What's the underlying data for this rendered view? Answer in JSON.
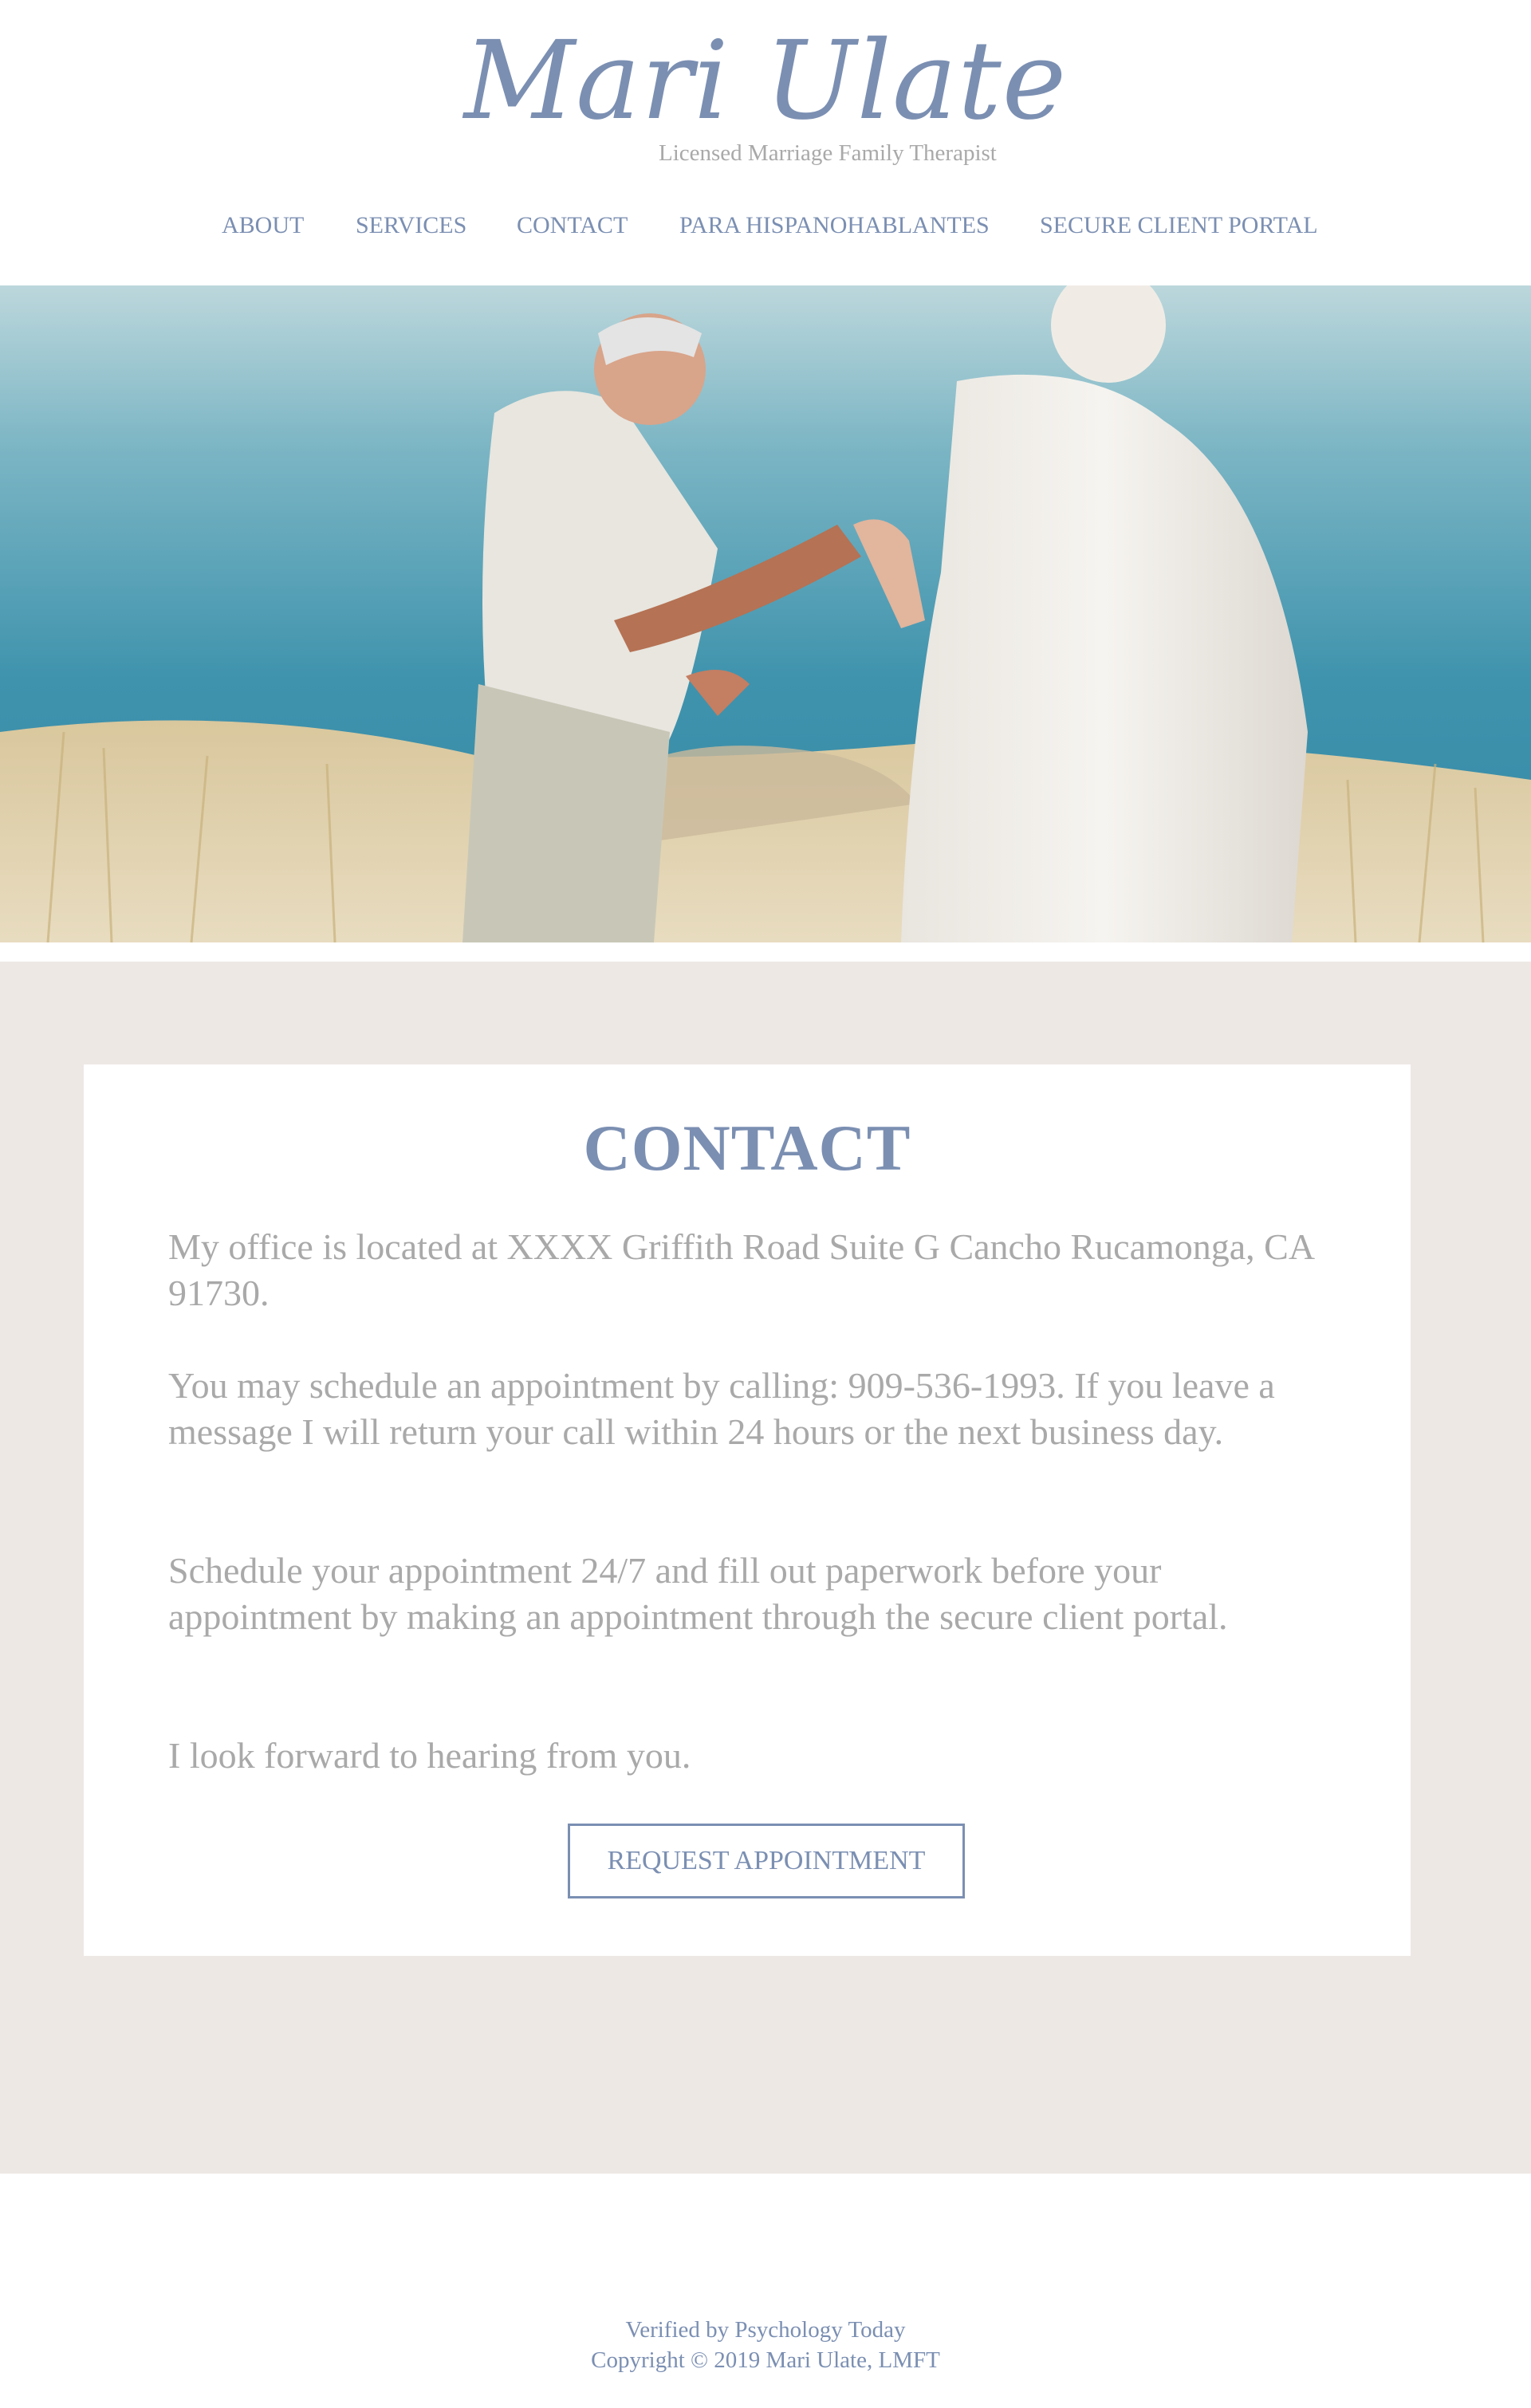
{
  "header": {
    "logo": "Mari Ulate",
    "tagline": "Licensed Marriage Family Therapist"
  },
  "nav": {
    "items": [
      {
        "label": "ABOUT"
      },
      {
        "label": "SERVICES"
      },
      {
        "label": "CONTACT"
      },
      {
        "label": "PARA HISPANOHABLANTES"
      },
      {
        "label": "SECURE CLIENT PORTAL"
      }
    ]
  },
  "contact": {
    "title": "CONTACT",
    "paragraphs": [
      "My office is located at XXXX Griffith Road Suite G Cancho Rucamonga, CA 91730.",
      "You may schedule an appointment by calling: 909-536-1993. If you leave a message I will return your call within 24 hours or the next business day.",
      "Schedule your appointment 24/7 and fill out paperwork before your appointment by making an appointment through the secure client portal.",
      "I look forward to hearing from you."
    ],
    "button_label": "REQUEST APPOINTMENT"
  },
  "footer": {
    "verified": "Verified by Psychology Today",
    "copyright": "Copyright © 2019 Mari Ulate, LMFT"
  },
  "colors": {
    "accent": "#7b8fb2",
    "body_text": "#a9a9a9",
    "band_background": "#ede8e4"
  }
}
